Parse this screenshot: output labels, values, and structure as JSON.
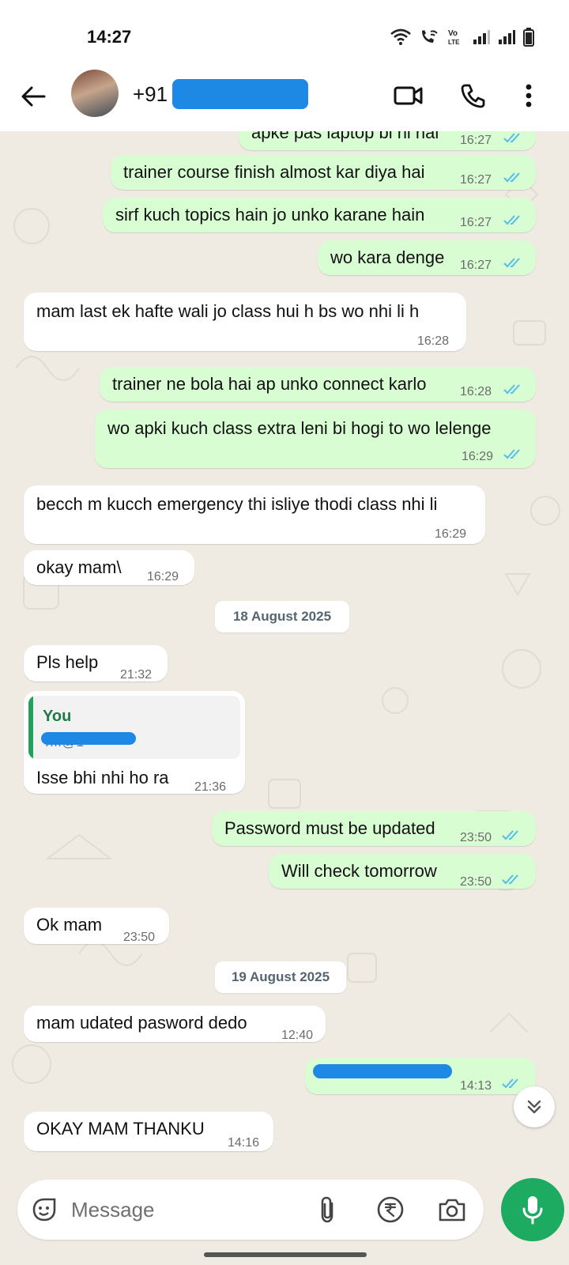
{
  "status_bar": {
    "time": "14:27"
  },
  "header": {
    "contact_name": "+91"
  },
  "messages": [
    {
      "dir": "out",
      "text": "apke pas laptop bi hi hai",
      "time": "16:27"
    },
    {
      "dir": "out",
      "text": "trainer course finish almost kar diya hai",
      "time": "16:27"
    },
    {
      "dir": "out",
      "text": "sirf kuch topics hain jo unko karane hain",
      "time": "16:27"
    },
    {
      "dir": "out",
      "text": "wo kara denge",
      "time": "16:27"
    },
    {
      "dir": "in",
      "text": "mam last ek hafte wali jo class hui h bs wo nhi li h",
      "time": "16:28"
    },
    {
      "dir": "out",
      "text": "trainer ne bola hai ap unko connect karlo",
      "time": "16:28"
    },
    {
      "dir": "out",
      "text": "wo apki kuch class extra leni bi hogi to wo lelenge",
      "time": "16:29"
    },
    {
      "dir": "in",
      "text": "becch m kucch emergency thi isliye thodi class nhi li",
      "time": "16:29"
    },
    {
      "dir": "in",
      "text": "okay mam\\",
      "time": "16:29"
    },
    {
      "dir": "date",
      "text": "18 August 2025"
    },
    {
      "dir": "in",
      "text": "Pls help",
      "time": "21:32"
    },
    {
      "dir": "in",
      "text": "Isse bhi nhi ho ra",
      "time": "21:36",
      "quote_author": "You",
      "quote_text": "T...@1"
    },
    {
      "dir": "out",
      "text": "Password must be updated",
      "time": "23:50"
    },
    {
      "dir": "out",
      "text": "Will check tomorrow",
      "time": "23:50"
    },
    {
      "dir": "in",
      "text": "Ok mam",
      "time": "23:50"
    },
    {
      "dir": "date",
      "text": "19 August 2025"
    },
    {
      "dir": "in",
      "text": "mam udated pasword dedo",
      "time": "12:40"
    },
    {
      "dir": "out",
      "text": "",
      "time": "14:13"
    },
    {
      "dir": "in",
      "text": "OKAY MAM THANKU",
      "time": "14:16"
    }
  ],
  "composer": {
    "placeholder": "Message"
  },
  "colors": {
    "outgoing_bubble": "#d9fdd3",
    "incoming_bubble": "#ffffff",
    "read_ticks": "#53bdeb",
    "mic_button": "#1daa61",
    "chat_background": "#efeae2"
  },
  "icons": [
    "back-arrow-icon",
    "video-call-icon",
    "voice-call-icon",
    "more-options-icon",
    "double-tick-icon",
    "chevron-double-down-icon",
    "sticker-icon",
    "attachment-icon",
    "rupee-payment-icon",
    "camera-icon",
    "microphone-icon"
  ]
}
